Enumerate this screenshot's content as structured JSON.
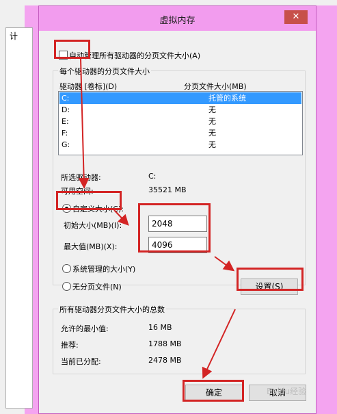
{
  "dialog": {
    "title": "虚拟内存",
    "close_label": "✕"
  },
  "background": {
    "tab_label": "计"
  },
  "auto_manage": {
    "label": "自动管理所有驱动器的分页文件大小(A)",
    "checked": false
  },
  "per_drive": {
    "group_label": "每个驱动器的分页文件大小",
    "col_drive": "驱动器 [卷标](D)",
    "col_size": "分页文件大小(MB)",
    "rows": [
      {
        "drive": "C:",
        "size": "托管的系统"
      },
      {
        "drive": "D:",
        "size": "无"
      },
      {
        "drive": "E:",
        "size": "无"
      },
      {
        "drive": "F:",
        "size": "无"
      },
      {
        "drive": "G:",
        "size": "无"
      }
    ],
    "selected_drive_label": "所选驱动器:",
    "selected_drive_value": "C:",
    "free_space_label": "可用空间:",
    "free_space_value": "35521 MB",
    "custom_label": "自定义大小(C):",
    "initial_label": "初始大小(MB)(I):",
    "initial_value": "2048",
    "max_label": "最大值(MB)(X):",
    "max_value": "4096",
    "system_managed_label": "系统管理的大小(Y)",
    "no_paging_label": "无分页文件(N)",
    "set_button": "设置(S)"
  },
  "totals": {
    "group_label": "所有驱动器分页文件大小的总数",
    "min_label": "允许的最小值:",
    "min_value": "16 MB",
    "recommended_label": "推荐:",
    "recommended_value": "1788 MB",
    "allocated_label": "当前已分配:",
    "allocated_value": "2478 MB"
  },
  "buttons": {
    "ok": "确定",
    "cancel": "取消"
  },
  "watermark": "Baidu经验",
  "colors": {
    "titlebar": "#f29cee",
    "close": "#c7504a",
    "selection": "#3399ff",
    "annotation": "#d32424"
  }
}
